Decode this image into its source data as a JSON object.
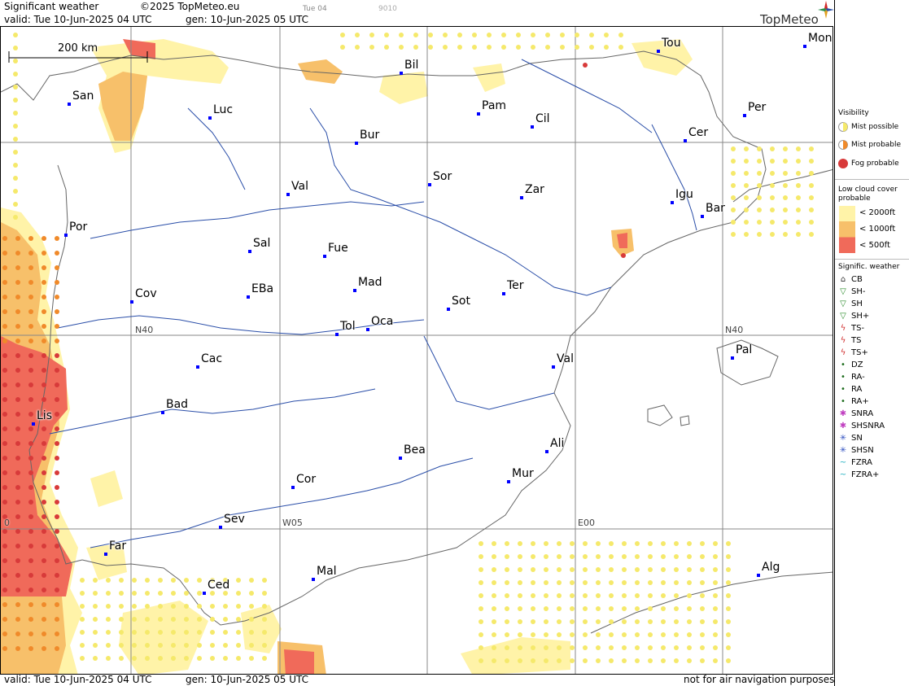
{
  "header": {
    "title": "Significant weather",
    "copyright": "©2025 TopMeteo.eu",
    "tab_day": "Tue 04",
    "code": "9010",
    "valid": "valid:  Tue  10-Jun-2025  04 UTC",
    "gen": "gen: 10-Jun-2025 05 UTC",
    "logo": "TopMeteo"
  },
  "footer": {
    "valid": "valid:  Tue  10-Jun-2025  04 UTC",
    "gen": "gen: 10-Jun-2025 05 UTC",
    "disclaimer": "not for air navigation purposes"
  },
  "scale": {
    "label": "200 km"
  },
  "grid_labels": [
    "N40",
    "N40",
    "W05",
    "E00",
    "0"
  ],
  "cities": [
    "Tou",
    "Mon",
    "Bil",
    "San",
    "Luc",
    "Pam",
    "Cil",
    "Per",
    "Bur",
    "Cer",
    "Sor",
    "Val",
    "Zar",
    "Igu",
    "Bar",
    "Por",
    "Sal",
    "Fue",
    "Mad",
    "EBa",
    "Cov",
    "Ter",
    "Sot",
    "Tol",
    "Oca",
    "Pal",
    "Cac",
    "Val",
    "Bad",
    "Lis",
    "Bea",
    "Ali",
    "Mur",
    "Cor",
    "Sev",
    "Far",
    "Mal",
    "Alg",
    "Ced"
  ],
  "legend": {
    "visibility_title": "Visibility",
    "visibility": [
      "Mist possible",
      "Mist probable",
      "Fog probable"
    ],
    "low_cloud_title": "Low cloud cover probable",
    "low_cloud": [
      "< 2000ft",
      "< 1000ft",
      "<  500ft"
    ],
    "sigwx_title": "Signific. weather",
    "sigwx": [
      "CB",
      "SH-",
      "SH",
      "SH+",
      "TS-",
      "TS",
      "TS+",
      "DZ",
      "RA-",
      "RA",
      "RA+",
      "SNRA",
      "SHSNRA",
      "SN",
      "SHSN",
      "FZRA",
      "FZRA+"
    ]
  },
  "colors": {
    "mist_possible": "#f5e96b",
    "mist_probable": "#f08a2a",
    "fog": "#d83a3a",
    "cloud_2000": "#fff3a8",
    "cloud_1000": "#f7c06a",
    "cloud_500": "#f06a5a",
    "river": "#2a4ea8",
    "coast": "#666666",
    "grid": "#888888"
  }
}
